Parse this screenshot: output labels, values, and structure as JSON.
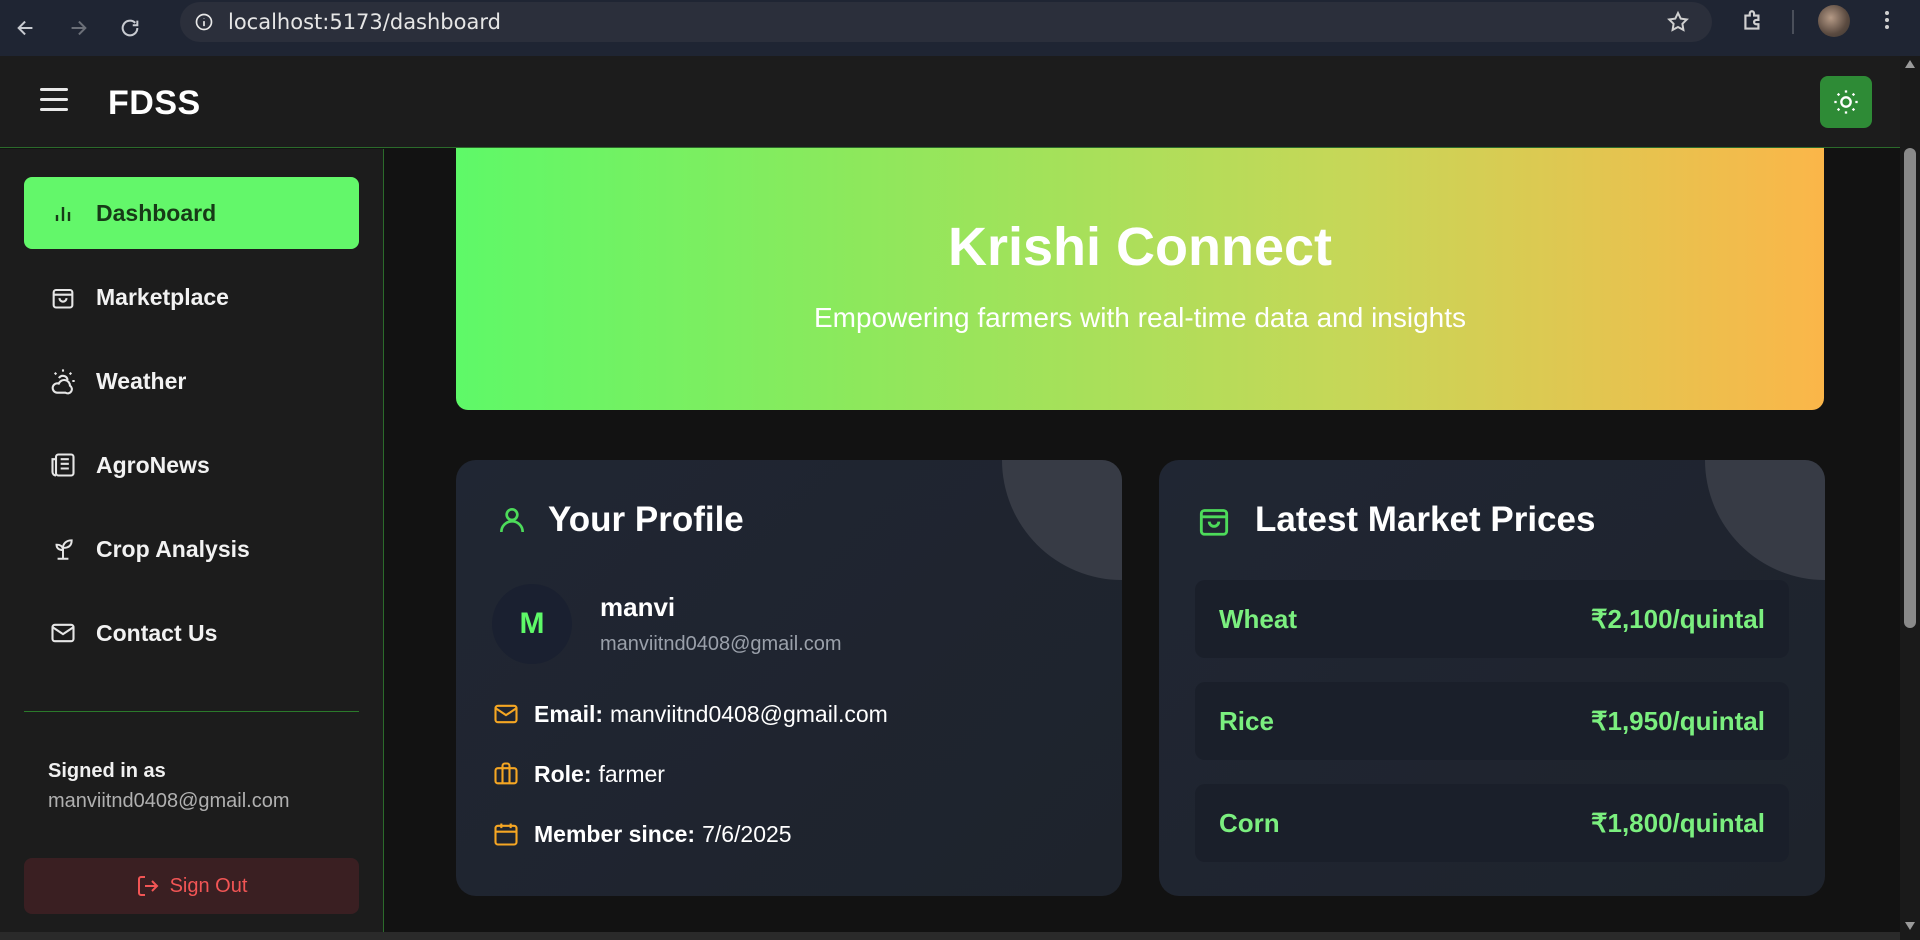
{
  "browser": {
    "url": "localhost:5173/dashboard"
  },
  "header": {
    "brand": "FDSS"
  },
  "sidebar": {
    "items": [
      {
        "label": "Dashboard",
        "icon": "bar-chart-icon",
        "active": true
      },
      {
        "label": "Marketplace",
        "icon": "shopping-bag-icon",
        "active": false
      },
      {
        "label": "Weather",
        "icon": "cloud-sun-icon",
        "active": false
      },
      {
        "label": "AgroNews",
        "icon": "newspaper-icon",
        "active": false
      },
      {
        "label": "Crop Analysis",
        "icon": "sprout-icon",
        "active": false
      },
      {
        "label": "Contact Us",
        "icon": "mail-icon",
        "active": false
      }
    ],
    "signed_in_label": "Signed in as",
    "signed_in_email": "manviitnd0408@gmail.com",
    "sign_out_label": "Sign Out"
  },
  "hero": {
    "title": "Krishi Connect",
    "subtitle": "Empowering farmers with real-time data and insights"
  },
  "profile": {
    "title": "Your Profile",
    "avatar_initial": "M",
    "name": "manvi",
    "email_sub": "manviitnd0408@gmail.com",
    "rows": [
      {
        "label": "Email:",
        "value": "manviitnd0408@gmail.com",
        "icon": "mail-icon"
      },
      {
        "label": "Role:",
        "value": "farmer",
        "icon": "briefcase-icon"
      },
      {
        "label": "Member since:",
        "value": "7/6/2025",
        "icon": "calendar-icon"
      }
    ]
  },
  "market": {
    "title": "Latest Market Prices",
    "prices": [
      {
        "crop": "Wheat",
        "price": "₹2,100/quintal"
      },
      {
        "crop": "Rice",
        "price": "₹1,950/quintal"
      },
      {
        "crop": "Corn",
        "price": "₹1,800/quintal"
      }
    ]
  },
  "colors": {
    "accent_green": "#63f76a",
    "theme_button": "#2e8b36",
    "sign_out_red": "#f25555",
    "price_green": "#7bef7f",
    "info_icon_orange": "#f5a623"
  }
}
